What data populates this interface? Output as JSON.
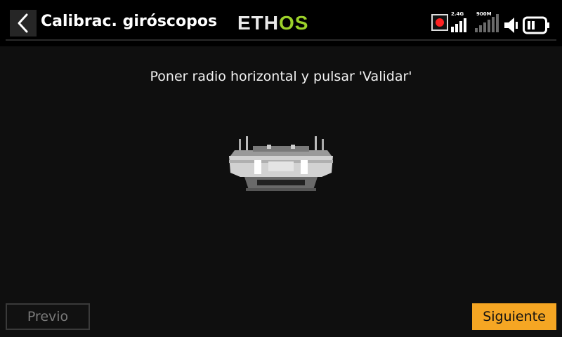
{
  "header": {
    "title": "Calibrac. giróscopos",
    "logo": {
      "part1": "ETH",
      "part2": "OS"
    },
    "status": {
      "rf1_label": "2.4G",
      "rf2_label": "900M"
    }
  },
  "main": {
    "instruction": "Poner radio horizontal y pulsar 'Validar'"
  },
  "footer": {
    "prev_label": "Previo",
    "next_label": "Siguiente"
  },
  "colors": {
    "accent": "#f5a623",
    "logo_green": "#9cd12a",
    "record_red": "#ff2222"
  },
  "icons": {
    "back": "chevron-left-icon",
    "record": "record-icon",
    "signal_24": "signal-bars-icon",
    "signal_900": "signal-bars-icon",
    "volume": "speaker-icon",
    "battery": "battery-icon"
  }
}
